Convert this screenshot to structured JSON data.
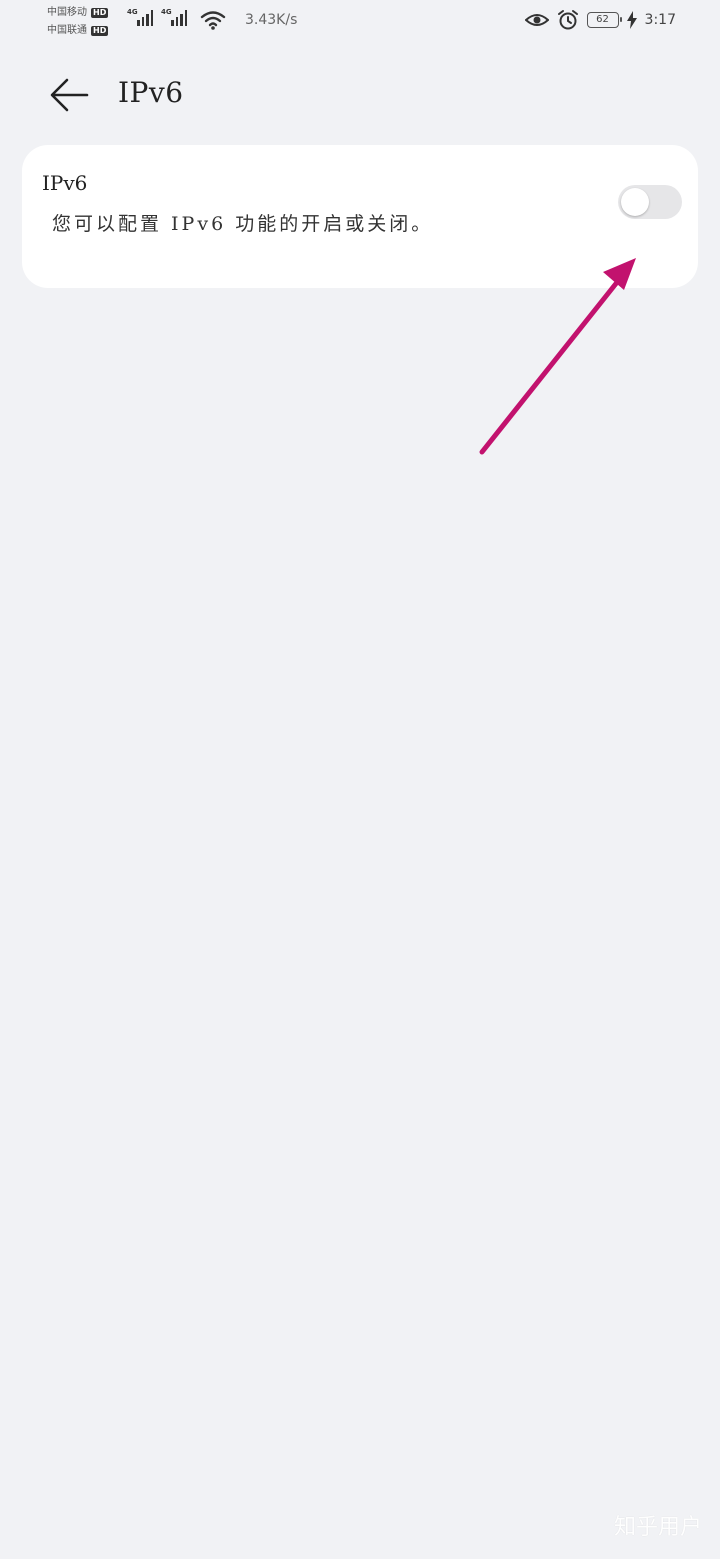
{
  "status_bar": {
    "carrier_1": "中国移动",
    "carrier_2": "中国联通",
    "hd_badge": "HD",
    "network_type_1": "4G",
    "network_type_2": "4G",
    "net_speed": "3.43K/s",
    "battery_level": "62",
    "time": "3:17",
    "icons": [
      "signal-icon",
      "wifi-icon",
      "eye-icon",
      "alarm-icon",
      "battery-icon",
      "charging-icon"
    ]
  },
  "header": {
    "back_icon": "back-arrow-icon",
    "title": "IPv6"
  },
  "settings": {
    "ipv6": {
      "title": "IPv6",
      "description": "您可以配置 IPv6 功能的开启或关闭。",
      "enabled": false
    }
  },
  "annotation": {
    "arrow_color": "#c2126e"
  },
  "watermark": "知乎用户"
}
